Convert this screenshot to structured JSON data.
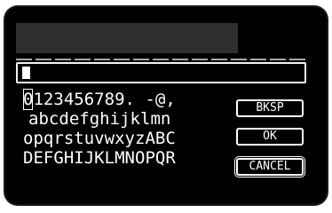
{
  "input": {
    "value": ""
  },
  "keyboard": {
    "rows": [
      [
        "0",
        "1",
        "2",
        "3",
        "4",
        "5",
        "6",
        "7",
        "8",
        "9",
        ".",
        " ",
        "-",
        "@",
        ","
      ],
      [
        "a",
        "b",
        "c",
        "d",
        "e",
        "f",
        "g",
        "h",
        "i",
        "j",
        "k",
        "l",
        "m",
        "n"
      ],
      [
        "o",
        "p",
        "q",
        "r",
        "s",
        "t",
        "u",
        "v",
        "w",
        "x",
        "y",
        "z",
        "A",
        "B",
        "C"
      ],
      [
        "D",
        "E",
        "F",
        "G",
        "H",
        "I",
        "J",
        "K",
        "L",
        "M",
        "N",
        "O",
        "P",
        "Q",
        "R"
      ]
    ],
    "selected": "0"
  },
  "actions": {
    "bksp_label": "BKSP",
    "ok_label": "OK",
    "cancel_label": "CANCEL"
  },
  "colors": {
    "background": "#000000",
    "foreground": "#ffffff",
    "top_band": "#2f2f2f"
  }
}
